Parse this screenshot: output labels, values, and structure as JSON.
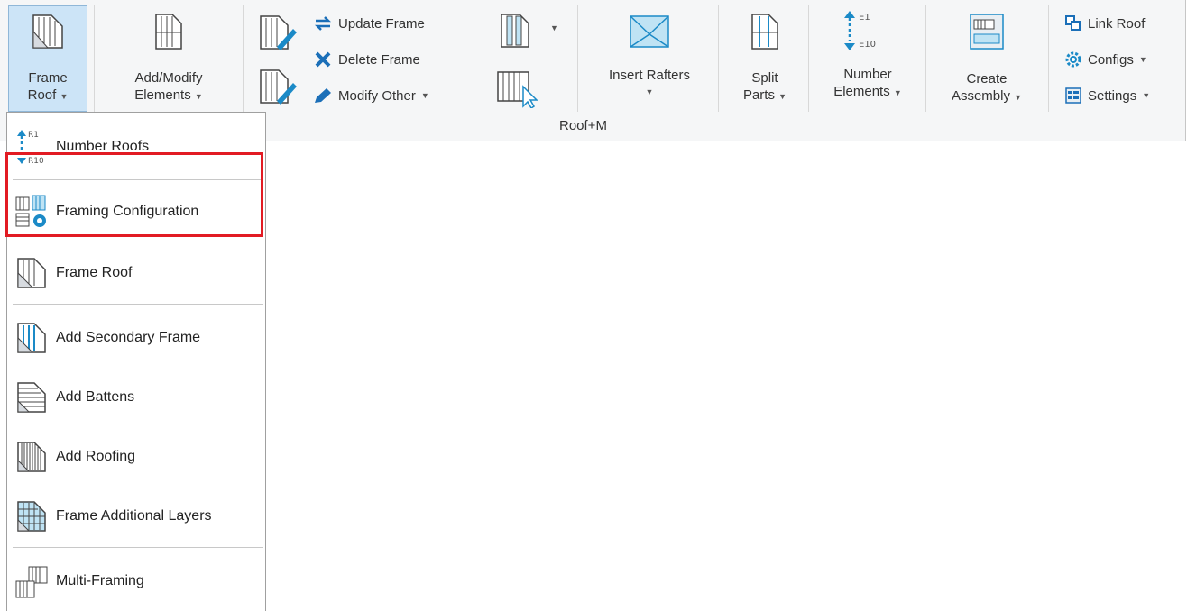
{
  "ribbon": {
    "panel_label": "Roof+M",
    "buttons": {
      "frame_roof": {
        "line1": "Frame",
        "line2": "Roof"
      },
      "add_modify": {
        "line1": "Add/Modify",
        "line2": "Elements"
      },
      "update_frame": "Update Frame",
      "delete_frame": "Delete Frame",
      "modify_other": "Modify Other",
      "insert_rafters": "Insert Rafters",
      "split_parts": {
        "line1": "Split",
        "line2": "Parts"
      },
      "number_elements": {
        "line1": "Number",
        "line2": "Elements",
        "icon_top": "E1",
        "icon_bottom": "E10"
      },
      "create_assembly": {
        "line1": "Create",
        "line2": "Assembly"
      },
      "link_roof": "Link Roof",
      "configs": "Configs",
      "settings": "Settings"
    }
  },
  "menu": {
    "number_roofs": {
      "label": "Number Roofs",
      "icon_top": "R1",
      "icon_bottom": "R10"
    },
    "framing_configuration": "Framing Configuration",
    "frame_roof": "Frame Roof",
    "add_secondary_frame": "Add Secondary Frame",
    "add_battens": "Add Battens",
    "add_roofing": "Add Roofing",
    "frame_additional_layers": "Frame Additional Layers",
    "multi_framing": "Multi-Framing"
  },
  "colors": {
    "accent": "#1b8ac7",
    "highlight": "#e21b23",
    "selected_bg": "#cce4f7"
  }
}
